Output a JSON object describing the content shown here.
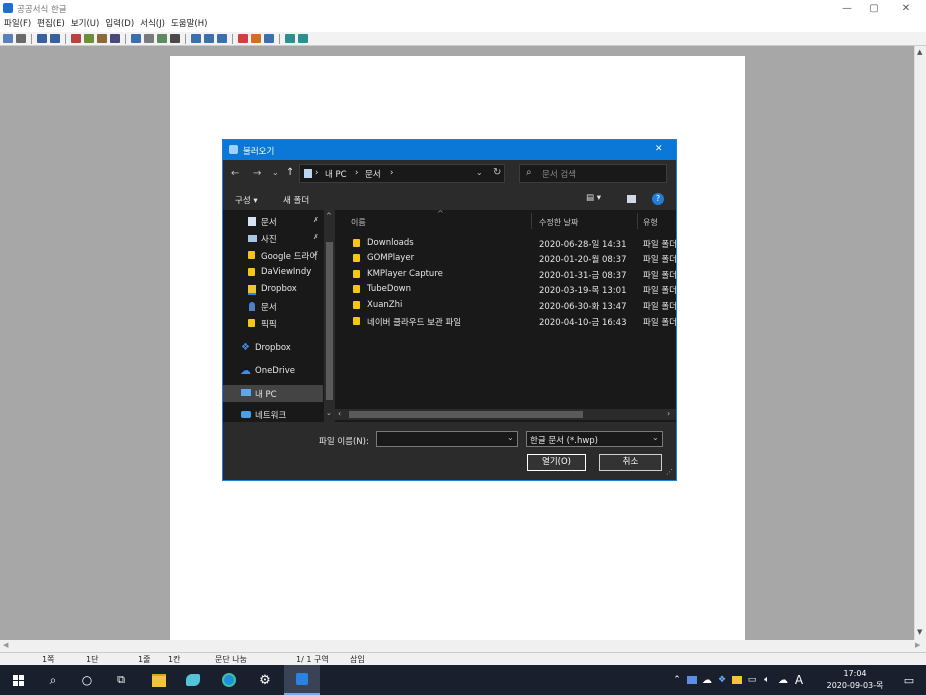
{
  "window": {
    "title": "공공서식 한글",
    "minimize": "—",
    "maximize": "▢",
    "close": "✕"
  },
  "menu": [
    "파일(F)",
    "편집(E)",
    "보기(U)",
    "입력(D)",
    "서식(J)",
    "도움말(H)"
  ],
  "status": {
    "page": "1쪽",
    "section": "1단",
    "line": "1줄",
    "col": "1칸",
    "mode": "문단 나눔",
    "pages": "1/ 1 구역",
    "insert": "삽입"
  },
  "dialog": {
    "title": "불러오기",
    "close": "✕",
    "breadcrumb": [
      "내 PC",
      "문서"
    ],
    "search_placeholder": "문서 검색",
    "organize": "구성 ▾",
    "new_folder": "새 폴더",
    "help": "?",
    "nav_items": [
      {
        "label": "문서",
        "icon": "document-icon",
        "pin": "✗"
      },
      {
        "label": "사진",
        "icon": "picture-icon",
        "pin": "✗"
      },
      {
        "label": "Google 드라이",
        "icon": "google-drive-icon",
        "pin": "✗"
      },
      {
        "label": "DaViewIndy",
        "icon": "folder-icon",
        "pin": ""
      },
      {
        "label": "Dropbox",
        "icon": "dropbox-icon",
        "pin": ""
      },
      {
        "label": "문서",
        "icon": "person-icon",
        "pin": ""
      },
      {
        "label": "픽픽",
        "icon": "folder-icon",
        "pin": ""
      },
      {
        "label": "Dropbox",
        "icon": "dropbox-icon",
        "pin": ""
      },
      {
        "label": "OneDrive",
        "icon": "cloud-icon",
        "pin": ""
      },
      {
        "label": "내 PC",
        "icon": "pc-icon",
        "pin": ""
      },
      {
        "label": "네트워크",
        "icon": "network-icon",
        "pin": ""
      }
    ],
    "columns": {
      "name": "이름",
      "date": "수정한 날짜",
      "type": "유형"
    },
    "files": [
      {
        "name": "Downloads",
        "date": "2020-06-28-일 14:31",
        "type": "파일 폴더"
      },
      {
        "name": "GOMPlayer",
        "date": "2020-01-20-월 08:37",
        "type": "파일 폴더"
      },
      {
        "name": "KMPlayer Capture",
        "date": "2020-01-31-금 08:37",
        "type": "파일 폴더"
      },
      {
        "name": "TubeDown",
        "date": "2020-03-19-목 13:01",
        "type": "파일 폴더"
      },
      {
        "name": "XuanZhi",
        "date": "2020-06-30-화 13:47",
        "type": "파일 폴더"
      },
      {
        "name": "네이버 클라우드 보관 파일",
        "date": "2020-04-10-금 16:43",
        "type": "파일 폴더"
      }
    ],
    "filename_label": "파일 이름(N):",
    "filename_value": "",
    "filetype": "한글 문서 (*.hwp)",
    "open_button": "열기(O)",
    "cancel_button": "취소"
  },
  "taskbar": {
    "time": "17:04",
    "date": "2020-09-03-목",
    "ime": "A"
  }
}
